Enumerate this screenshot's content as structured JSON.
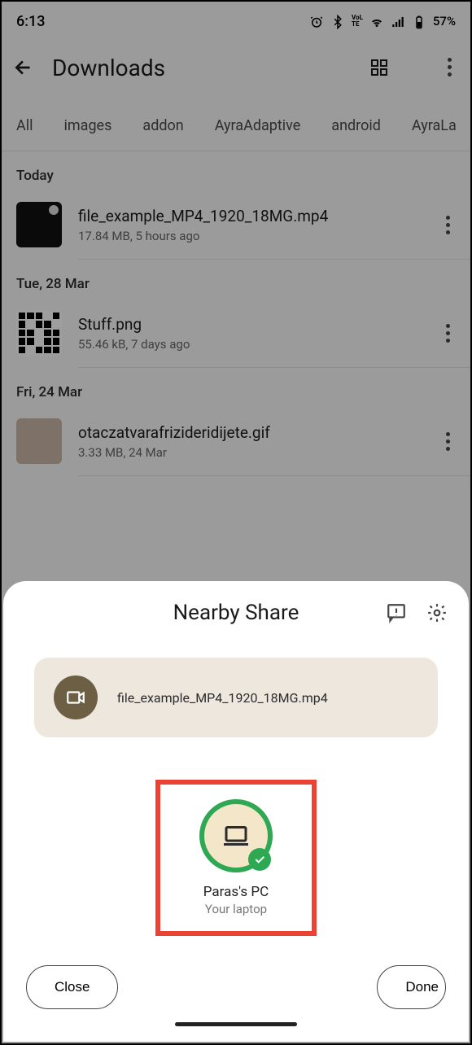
{
  "status": {
    "time": "6:13",
    "battery_pct": "57%"
  },
  "downloads": {
    "title": "Downloads",
    "tabs": [
      "All",
      "images",
      "addon",
      "AyraAdaptive",
      "android",
      "AyraLa"
    ],
    "sections": [
      {
        "label": "Today",
        "items": [
          {
            "name": "file_example_MP4_1920_18MG.mp4",
            "meta": "17.84 MB, 5 hours ago"
          }
        ]
      },
      {
        "label": "Tue, 28 Mar",
        "items": [
          {
            "name": "Stuff.png",
            "meta": "55.46 kB, 7 days ago"
          }
        ]
      },
      {
        "label": "Fri, 24 Mar",
        "items": [
          {
            "name": "otaczatvarafrizideridijete.gif",
            "meta": "3.33 MB, 24 Mar"
          }
        ]
      }
    ]
  },
  "share_sheet": {
    "title": "Nearby Share",
    "file_name": "file_example_MP4_1920_18MG.mp4",
    "device": {
      "name": "Paras's PC",
      "subtitle": "Your laptop"
    },
    "close_label": "Close",
    "done_label": "Done"
  }
}
